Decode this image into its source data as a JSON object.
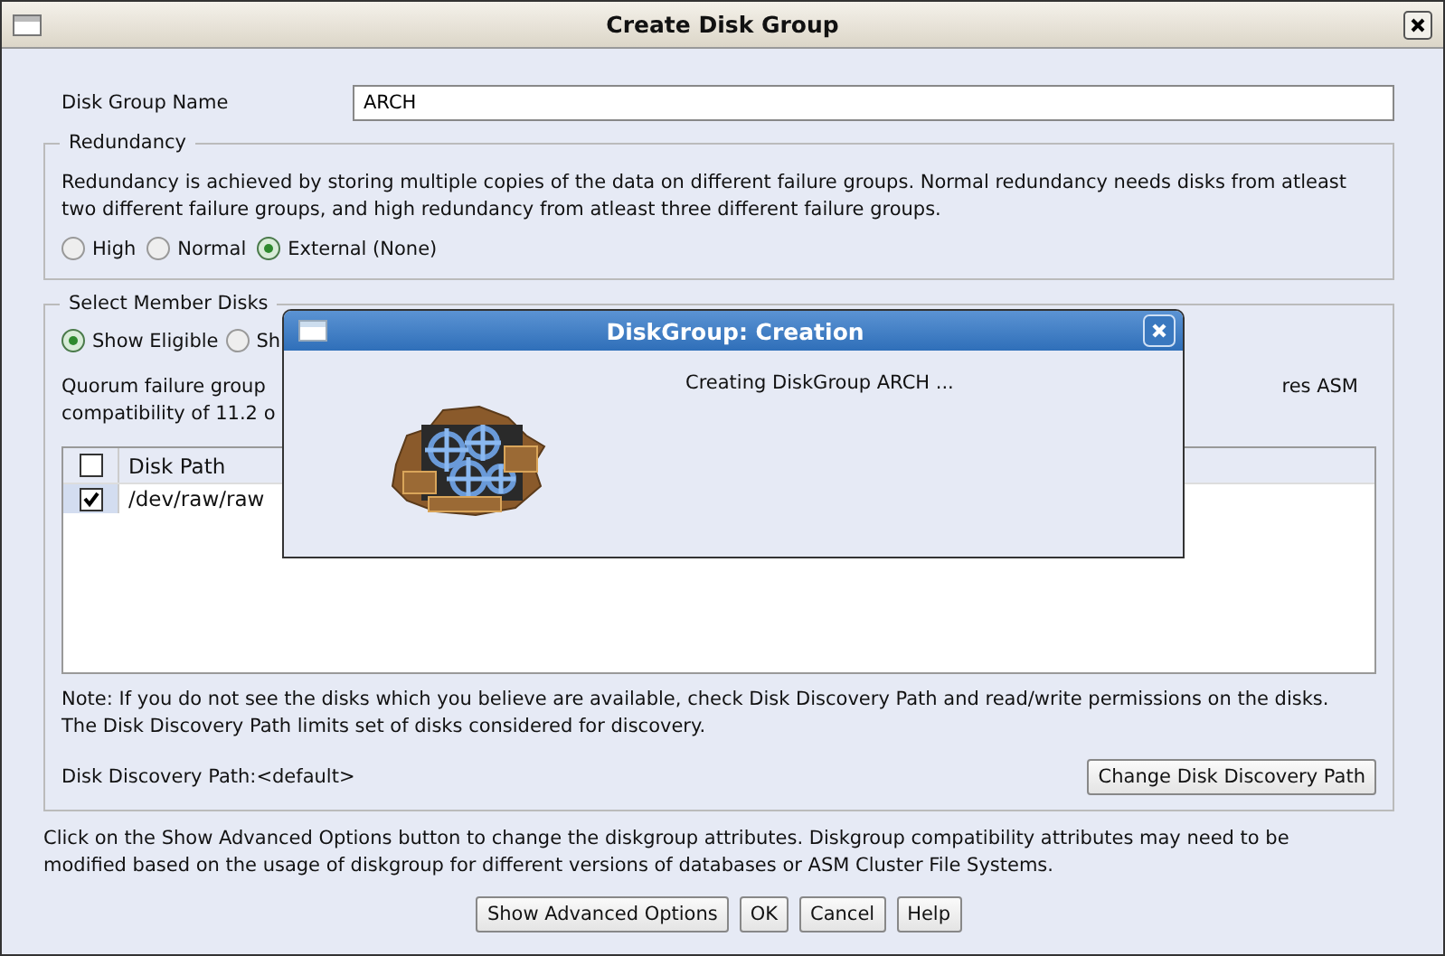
{
  "window": {
    "title": "Create Disk Group"
  },
  "disk_group_name": {
    "label": "Disk Group Name",
    "value": "ARCH"
  },
  "redundancy": {
    "legend": "Redundancy",
    "description": "Redundancy is achieved by storing multiple copies of the data on different failure groups. Normal redundancy needs disks from atleast two different failure groups, and high redundancy from atleast three different failure groups.",
    "options": [
      {
        "label": "High",
        "selected": false
      },
      {
        "label": "Normal",
        "selected": false
      },
      {
        "label": "External (None)",
        "selected": true
      }
    ]
  },
  "member_disks": {
    "legend": "Select Member Disks",
    "filters": [
      {
        "label": "Show Eligible",
        "selected": true
      },
      {
        "label": "Sh",
        "selected": false
      }
    ],
    "quorum_text_left": "Quorum failure group\ncompatibility of 11.2 o",
    "quorum_text_right": "res ASM",
    "table": {
      "header_checked": false,
      "columns": [
        "Disk Path"
      ],
      "rows": [
        {
          "checked": true,
          "disk_path": "/dev/raw/raw"
        }
      ]
    },
    "note": "Note: If you do not see the disks which you believe are available, check Disk Discovery Path and read/write permissions on the disks. The Disk Discovery Path limits set of disks considered for discovery.",
    "discovery_path": "Disk Discovery Path:<default>",
    "change_button": "Change Disk Discovery Path"
  },
  "advanced_note": "Click on the Show Advanced Options button to change the diskgroup attributes. Diskgroup compatibility attributes may need to be modified based on the usage of diskgroup for different versions of databases or ASM Cluster File Systems.",
  "buttons": [
    "Show Advanced Options",
    "OK",
    "Cancel",
    "Help"
  ],
  "progress_dialog": {
    "title": "DiskGroup: Creation",
    "message": "Creating DiskGroup ARCH ..."
  }
}
